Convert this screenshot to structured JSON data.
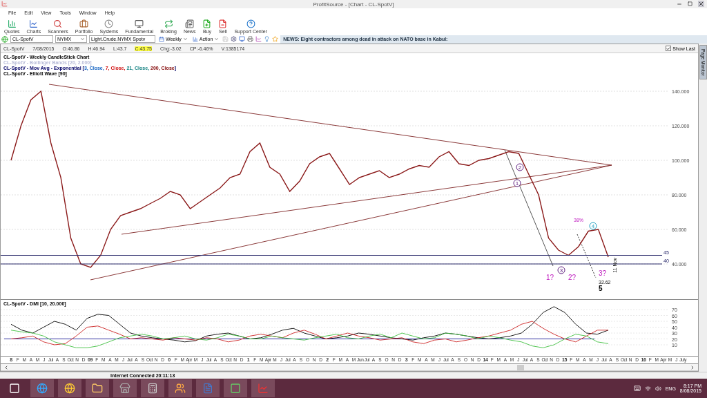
{
  "window": {
    "title": "ProfitSource - [Chart - CL-SpotV]"
  },
  "menu": [
    "File",
    "Edit",
    "View",
    "Tools",
    "Window",
    "Help"
  ],
  "toolbar": [
    {
      "label": "Quotes",
      "kind": "quotes"
    },
    {
      "label": "Charts",
      "kind": "charts"
    },
    {
      "label": "Scanners",
      "kind": "scanners"
    },
    {
      "label": "Portfolio",
      "kind": "portfolio"
    },
    {
      "label": "Systems",
      "kind": "systems"
    },
    {
      "label": "Fundamental",
      "kind": "fundamental"
    },
    {
      "label": "Broking",
      "kind": "broking"
    },
    {
      "label": "News",
      "kind": "news"
    },
    {
      "label": "Buy",
      "kind": "buy"
    },
    {
      "label": "Sell",
      "kind": "sell"
    },
    {
      "label": "Support Center",
      "kind": "support"
    }
  ],
  "symbol_bar": {
    "symbol": "CL-SpotV",
    "exchange": "NYMX",
    "name": "Light.Crude.NYMX Spotv",
    "period": "Weekly",
    "action": "Action",
    "news": "NEWS: Eight contractors among dead in attack on NATO base in Kabul:"
  },
  "quote": {
    "symbol": "CL-SpotV",
    "date": "7/08/2015",
    "open": "O:46.86",
    "high": "H:46.94",
    "low": "L:43.7",
    "close": "C:43.75",
    "change": "Chg:-3.02",
    "change_pct": "CP:-6.46%",
    "volume": "V:1385174"
  },
  "show_last": {
    "label": "Show Last",
    "checked": true
  },
  "side_tab": "Page Monitor",
  "legend": [
    {
      "segments": [
        {
          "text": "CL-SpotV - Weekly CandleStick Chart",
          "kind": "plain"
        }
      ]
    },
    {
      "segments": [
        {
          "text": "CL-SpotV - Bollinger Bands [20, 2.000]",
          "kind": "faint"
        }
      ]
    },
    {
      "segments": [
        {
          "text": "CL-SpotV - Mov Avg - Exponential [",
          "kind": "navy"
        },
        {
          "text": "3, Close, ",
          "kind": "ema3"
        },
        {
          "text": "7, Close, ",
          "kind": "ema7"
        },
        {
          "text": "21, Close, ",
          "kind": "ema21"
        },
        {
          "text": "200, Close",
          "kind": "ema200"
        },
        {
          "text": "]",
          "kind": "navy"
        }
      ]
    },
    {
      "segments": [
        {
          "text": "CL-SpotV - Elliott Wave [90]",
          "kind": "plain"
        }
      ]
    }
  ],
  "price_chart": {
    "y_ticks": [
      "140.000",
      "120.000",
      "100.000",
      "80.000",
      "60.000",
      "40.000"
    ],
    "levels": [
      "45",
      "40"
    ],
    "wave_labels": [
      {
        "text": "1?",
        "kind": "plain"
      },
      {
        "text": "2?",
        "kind": "plain"
      },
      {
        "text": "3?",
        "kind": "plain"
      },
      {
        "text": "5",
        "kind": "bold"
      },
      {
        "text": "1",
        "kind": "circle"
      },
      {
        "text": "2",
        "kind": "circle"
      },
      {
        "text": "3",
        "kind": "circle"
      },
      {
        "text": "4",
        "kind": "circle_cyan"
      },
      {
        "text": "38%",
        "kind": "small"
      },
      {
        "text": "32.62",
        "kind": "small"
      }
    ],
    "vertical_note": "11 Nov"
  },
  "dmi_chart": {
    "title": "CL-SpotV - DMI [10, 20.000]",
    "y_ticks": [
      "70",
      "60",
      "50",
      "40",
      "30",
      "20",
      "10"
    ]
  },
  "x_axis": [
    {
      "year": "8",
      "months": [
        "F",
        "M",
        "A",
        "M",
        "J",
        "Jul",
        "A",
        "S",
        "Oct",
        "N",
        "D"
      ]
    },
    {
      "year": "09",
      "months": [
        "F",
        "M",
        "A",
        "M",
        "J",
        "Jul",
        "A",
        "S",
        "Oct",
        "N",
        "D"
      ]
    },
    {
      "year": "0",
      "months": [
        "F",
        "M",
        "Apr",
        "M",
        "J",
        "Jul",
        "A",
        "S",
        "Oct",
        "N",
        "D"
      ]
    },
    {
      "year": "1",
      "months": [
        "F",
        "M",
        "Apr",
        "M",
        "J",
        "Jul",
        "A",
        "S",
        "O",
        "N",
        "D"
      ]
    },
    {
      "year": "2",
      "months": [
        "F",
        "M",
        "A",
        "M",
        "Jun",
        "Jul",
        "A",
        "S",
        "O",
        "N",
        "D"
      ]
    },
    {
      "year": "3",
      "months": [
        "F",
        "M",
        "A",
        "M",
        "J",
        "Jul",
        "A",
        "S",
        "O",
        "N",
        "D"
      ]
    },
    {
      "year": "14",
      "months": [
        "F",
        "M",
        "A",
        "M",
        "J",
        "Jul",
        "A",
        "S",
        "Oct",
        "N",
        "D"
      ]
    },
    {
      "year": "15",
      "months": [
        "F",
        "M",
        "A",
        "M",
        "J",
        "Jul",
        "A",
        "S",
        "Oct",
        "N",
        "D"
      ]
    },
    {
      "year": "16",
      "months": [
        "F",
        "M",
        "Apr",
        "M",
        "J",
        "July"
      ]
    }
  ],
  "status_bar": {
    "connection": "Internet Connected 20:11:13"
  },
  "taskbar": {
    "apps": [
      {
        "kind": "start"
      },
      {
        "kind": "ie"
      },
      {
        "kind": "chrome"
      },
      {
        "kind": "folder"
      },
      {
        "kind": "store"
      },
      {
        "kind": "calculator"
      },
      {
        "kind": "contacts"
      },
      {
        "kind": "word"
      },
      {
        "kind": "app"
      },
      {
        "kind": "profitsource"
      }
    ],
    "language": "ENG",
    "time": "8:17 PM",
    "date": "8/08/2015"
  }
}
